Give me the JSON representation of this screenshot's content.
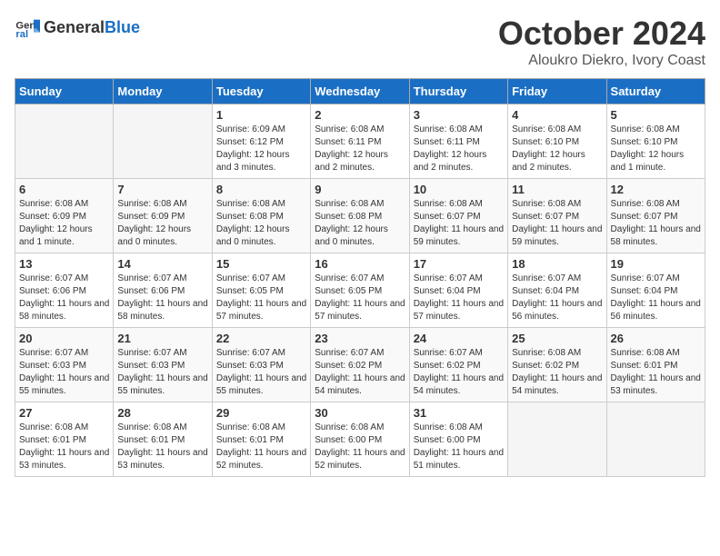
{
  "header": {
    "logo_general": "General",
    "logo_blue": "Blue",
    "month": "October 2024",
    "location": "Aloukro Diekro, Ivory Coast"
  },
  "weekdays": [
    "Sunday",
    "Monday",
    "Tuesday",
    "Wednesday",
    "Thursday",
    "Friday",
    "Saturday"
  ],
  "weeks": [
    [
      {
        "day": "",
        "empty": true
      },
      {
        "day": "",
        "empty": true
      },
      {
        "day": "1",
        "sunrise": "6:09 AM",
        "sunset": "6:12 PM",
        "daylight": "12 hours and 3 minutes."
      },
      {
        "day": "2",
        "sunrise": "6:08 AM",
        "sunset": "6:11 PM",
        "daylight": "12 hours and 2 minutes."
      },
      {
        "day": "3",
        "sunrise": "6:08 AM",
        "sunset": "6:11 PM",
        "daylight": "12 hours and 2 minutes."
      },
      {
        "day": "4",
        "sunrise": "6:08 AM",
        "sunset": "6:10 PM",
        "daylight": "12 hours and 2 minutes."
      },
      {
        "day": "5",
        "sunrise": "6:08 AM",
        "sunset": "6:10 PM",
        "daylight": "12 hours and 1 minute."
      }
    ],
    [
      {
        "day": "6",
        "sunrise": "6:08 AM",
        "sunset": "6:09 PM",
        "daylight": "12 hours and 1 minute."
      },
      {
        "day": "7",
        "sunrise": "6:08 AM",
        "sunset": "6:09 PM",
        "daylight": "12 hours and 0 minutes."
      },
      {
        "day": "8",
        "sunrise": "6:08 AM",
        "sunset": "6:08 PM",
        "daylight": "12 hours and 0 minutes."
      },
      {
        "day": "9",
        "sunrise": "6:08 AM",
        "sunset": "6:08 PM",
        "daylight": "12 hours and 0 minutes."
      },
      {
        "day": "10",
        "sunrise": "6:08 AM",
        "sunset": "6:07 PM",
        "daylight": "11 hours and 59 minutes."
      },
      {
        "day": "11",
        "sunrise": "6:08 AM",
        "sunset": "6:07 PM",
        "daylight": "11 hours and 59 minutes."
      },
      {
        "day": "12",
        "sunrise": "6:08 AM",
        "sunset": "6:07 PM",
        "daylight": "11 hours and 58 minutes."
      }
    ],
    [
      {
        "day": "13",
        "sunrise": "6:07 AM",
        "sunset": "6:06 PM",
        "daylight": "11 hours and 58 minutes."
      },
      {
        "day": "14",
        "sunrise": "6:07 AM",
        "sunset": "6:06 PM",
        "daylight": "11 hours and 58 minutes."
      },
      {
        "day": "15",
        "sunrise": "6:07 AM",
        "sunset": "6:05 PM",
        "daylight": "11 hours and 57 minutes."
      },
      {
        "day": "16",
        "sunrise": "6:07 AM",
        "sunset": "6:05 PM",
        "daylight": "11 hours and 57 minutes."
      },
      {
        "day": "17",
        "sunrise": "6:07 AM",
        "sunset": "6:04 PM",
        "daylight": "11 hours and 57 minutes."
      },
      {
        "day": "18",
        "sunrise": "6:07 AM",
        "sunset": "6:04 PM",
        "daylight": "11 hours and 56 minutes."
      },
      {
        "day": "19",
        "sunrise": "6:07 AM",
        "sunset": "6:04 PM",
        "daylight": "11 hours and 56 minutes."
      }
    ],
    [
      {
        "day": "20",
        "sunrise": "6:07 AM",
        "sunset": "6:03 PM",
        "daylight": "11 hours and 55 minutes."
      },
      {
        "day": "21",
        "sunrise": "6:07 AM",
        "sunset": "6:03 PM",
        "daylight": "11 hours and 55 minutes."
      },
      {
        "day": "22",
        "sunrise": "6:07 AM",
        "sunset": "6:03 PM",
        "daylight": "11 hours and 55 minutes."
      },
      {
        "day": "23",
        "sunrise": "6:07 AM",
        "sunset": "6:02 PM",
        "daylight": "11 hours and 54 minutes."
      },
      {
        "day": "24",
        "sunrise": "6:07 AM",
        "sunset": "6:02 PM",
        "daylight": "11 hours and 54 minutes."
      },
      {
        "day": "25",
        "sunrise": "6:08 AM",
        "sunset": "6:02 PM",
        "daylight": "11 hours and 54 minutes."
      },
      {
        "day": "26",
        "sunrise": "6:08 AM",
        "sunset": "6:01 PM",
        "daylight": "11 hours and 53 minutes."
      }
    ],
    [
      {
        "day": "27",
        "sunrise": "6:08 AM",
        "sunset": "6:01 PM",
        "daylight": "11 hours and 53 minutes."
      },
      {
        "day": "28",
        "sunrise": "6:08 AM",
        "sunset": "6:01 PM",
        "daylight": "11 hours and 53 minutes."
      },
      {
        "day": "29",
        "sunrise": "6:08 AM",
        "sunset": "6:01 PM",
        "daylight": "11 hours and 52 minutes."
      },
      {
        "day": "30",
        "sunrise": "6:08 AM",
        "sunset": "6:00 PM",
        "daylight": "11 hours and 52 minutes."
      },
      {
        "day": "31",
        "sunrise": "6:08 AM",
        "sunset": "6:00 PM",
        "daylight": "11 hours and 51 minutes."
      },
      {
        "day": "",
        "empty": true
      },
      {
        "day": "",
        "empty": true
      }
    ]
  ]
}
